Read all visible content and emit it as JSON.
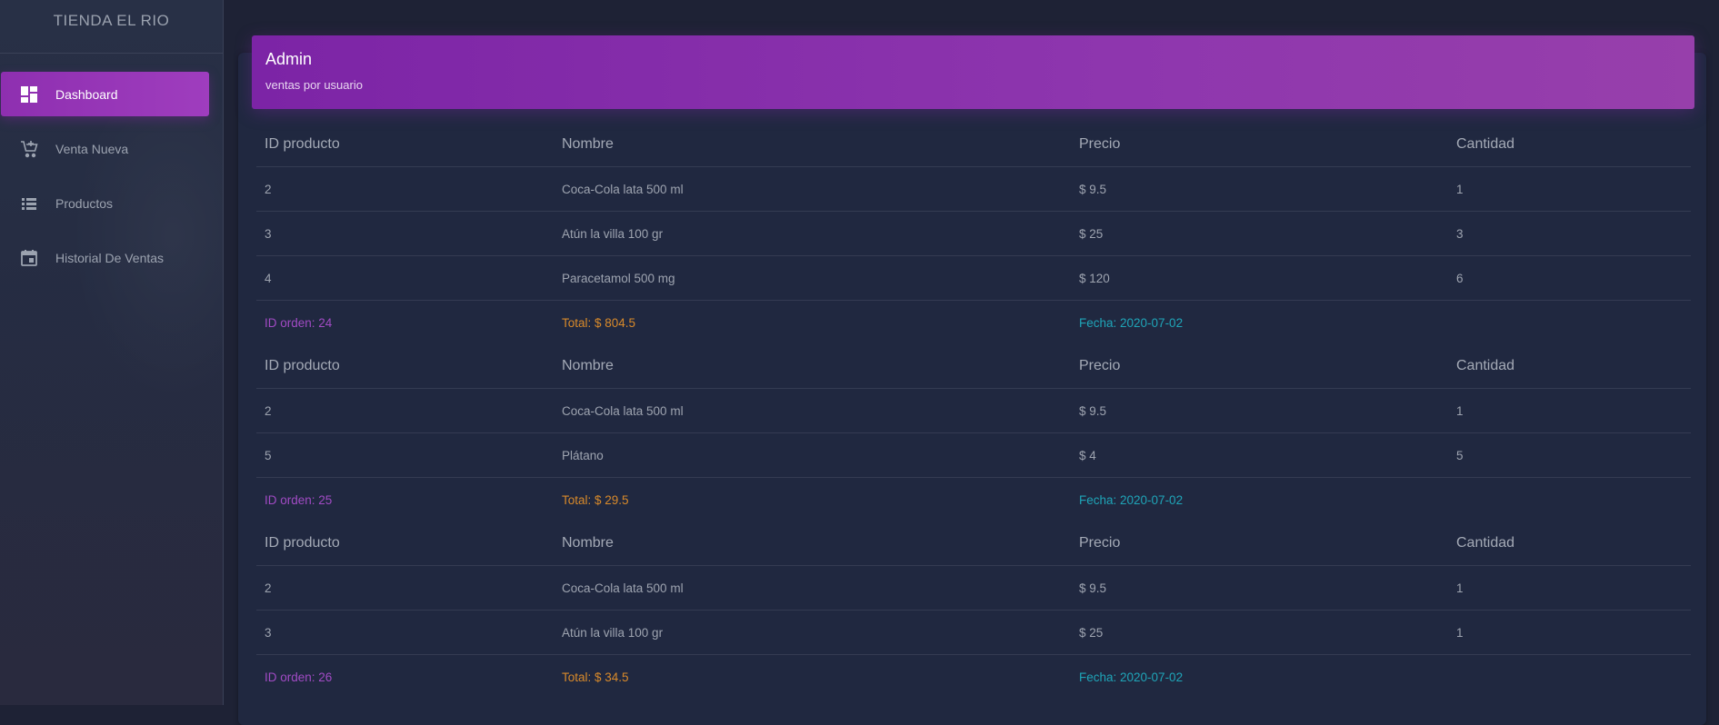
{
  "app": {
    "brand": "TIENDA EL RIO"
  },
  "sidebar": {
    "items": [
      {
        "label": "Dashboard",
        "icon": "dashboard-icon",
        "active": true
      },
      {
        "label": "Venta Nueva",
        "icon": "add-cart-icon",
        "active": false
      },
      {
        "label": "Productos",
        "icon": "list-icon",
        "active": false
      },
      {
        "label": "Historial De Ventas",
        "icon": "calendar-icon",
        "active": false
      }
    ]
  },
  "card": {
    "title": "Admin",
    "subtitle": "ventas por usuario"
  },
  "columns": {
    "id": "ID producto",
    "name": "Nombre",
    "price": "Precio",
    "qty": "Cantidad"
  },
  "orders": [
    {
      "items": [
        {
          "id": "2",
          "name": "Coca-Cola lata 500 ml",
          "price": "$ 9.5",
          "qty": "1"
        },
        {
          "id": "3",
          "name": "Atún la villa 100 gr",
          "price": "$ 25",
          "qty": "3"
        },
        {
          "id": "4",
          "name": "Paracetamol 500 mg",
          "price": "$ 120",
          "qty": "6"
        }
      ],
      "order_id": "ID orden: 24",
      "total": "Total: $ 804.5",
      "date": "Fecha: 2020-07-02"
    },
    {
      "items": [
        {
          "id": "2",
          "name": "Coca-Cola lata 500 ml",
          "price": "$ 9.5",
          "qty": "1"
        },
        {
          "id": "5",
          "name": "Plátano",
          "price": "$ 4",
          "qty": "5"
        }
      ],
      "order_id": "ID orden: 25",
      "total": "Total: $ 29.5",
      "date": "Fecha: 2020-07-02"
    },
    {
      "items": [
        {
          "id": "2",
          "name": "Coca-Cola lata 500 ml",
          "price": "$ 9.5",
          "qty": "1"
        },
        {
          "id": "3",
          "name": "Atún la villa 100 gr",
          "price": "$ 25",
          "qty": "1"
        }
      ],
      "order_id": "ID orden: 26",
      "total": "Total: $ 34.5",
      "date": "Fecha: 2020-07-02"
    }
  ],
  "colors": {
    "accent": "#9c27b0",
    "order_id": "#a14bc4",
    "total": "#d98a2a",
    "date": "#1fa5b8"
  }
}
